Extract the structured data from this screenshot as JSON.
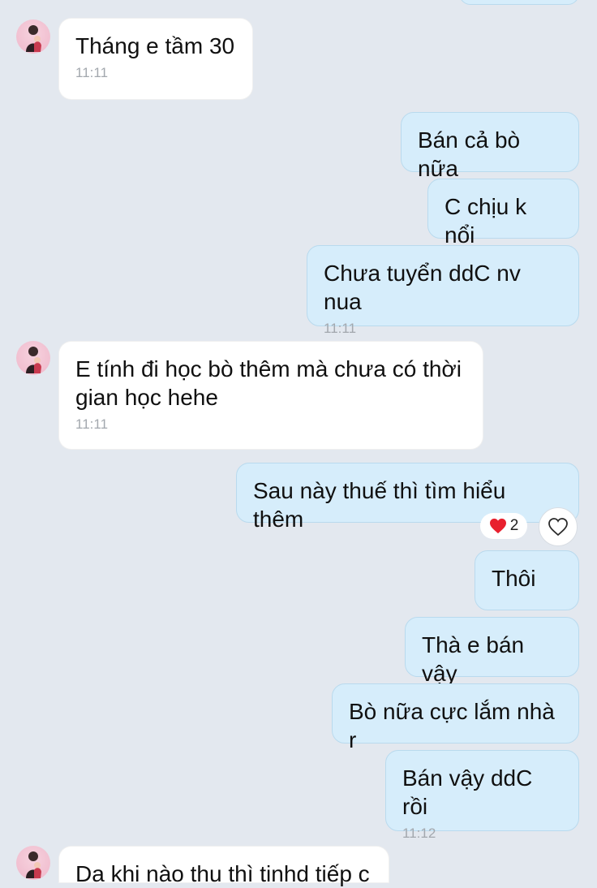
{
  "messages": [
    {
      "side": "in",
      "text": "Tháng e tầm 30",
      "time": "11:11"
    },
    {
      "side": "out",
      "text": "Bán cả bò nữa"
    },
    {
      "side": "out",
      "text": "C chịu k nổi"
    },
    {
      "side": "out",
      "text": "Chưa tuyển ddC nv nua",
      "time": "11:11"
    },
    {
      "side": "in",
      "text": "E tính đi học bò thêm mà chưa có thời gian học hehe",
      "time": "11:11"
    },
    {
      "side": "out",
      "text": "Sau này thuế thì tìm hiểu thêm",
      "reaction": {
        "icon": "heart-icon",
        "count": "2"
      }
    },
    {
      "side": "out",
      "text": "Thôi"
    },
    {
      "side": "out",
      "text": "Thà e bán vậy"
    },
    {
      "side": "out",
      "text": "Bò nữa cực lắm nhà r"
    },
    {
      "side": "out",
      "text": "Bán vậy ddC rồi",
      "time": "11:12"
    },
    {
      "side": "in",
      "text": "Da khi nào thu thì tinhd tiếp c"
    }
  ],
  "colors": {
    "background": "#e3e8ef",
    "incoming_bubble": "#ffffff",
    "outgoing_bubble": "#d6edfb",
    "reaction_heart": "#e8202e"
  },
  "icons": {
    "like_button": "heart-outline-icon",
    "avatar": "avatar-icon"
  }
}
